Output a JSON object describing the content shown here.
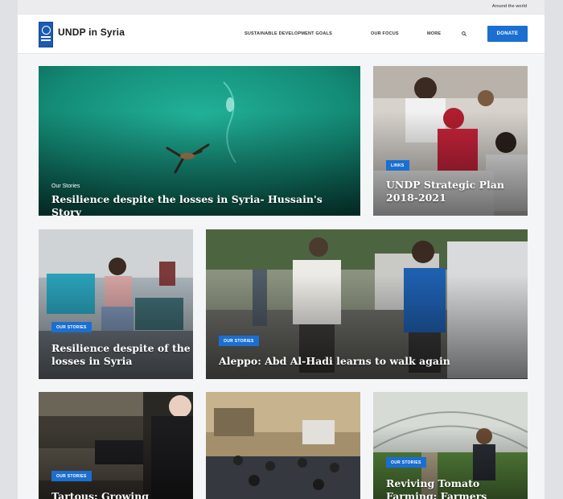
{
  "topbar": {
    "link": "Around the world"
  },
  "header": {
    "site_title": "UNDP in Syria",
    "nav": [
      "SUSTAINABLE DEVELOPMENT GOALS",
      "OUR FOCUS",
      "MORE"
    ],
    "donate_label": "DONATE"
  },
  "cards": {
    "hero": {
      "kicker": "Our Stories",
      "title": "Resilience despite the losses in Syria- Hussain's Story"
    },
    "strategic": {
      "badge": "LINKS",
      "title_line1": "UNDP Strategic Plan",
      "title_line2": "2018-2021"
    },
    "resilience": {
      "badge": "OUR STORIES",
      "title_line1": "Resilience despite of the",
      "title_line2": "losses in Syria"
    },
    "aleppo": {
      "badge": "OUR STORIES",
      "title": "Aleppo: Abd Al-Hadi learns to walk again"
    },
    "tartous": {
      "badge": "OUR STORIES",
      "title": "Tartous: Growing"
    },
    "tomato": {
      "badge": "OUR STORIES",
      "title_line1": "Reviving Tomato",
      "title_line2": "Farming: Farmers"
    }
  },
  "colors": {
    "accent": "#1a6fd0",
    "header_bg": "#ffffff",
    "page_bg": "#f4f5f6"
  },
  "icons": {
    "search": "search-icon",
    "logo": "undp-logo-icon"
  }
}
